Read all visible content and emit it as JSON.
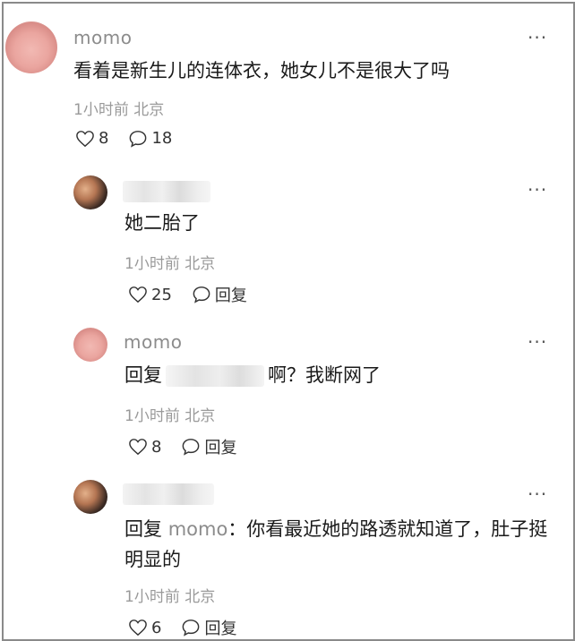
{
  "comments": [
    {
      "username": "momo",
      "text": "看着是新生儿的连体衣，她女儿不是很大了吗",
      "time": "1小时前",
      "location": "北京",
      "likes": "8",
      "replies": "18",
      "more": "···"
    },
    {
      "username": "",
      "text": "她二胎了",
      "time": "1小时前",
      "location": "北京",
      "likes": "25",
      "reply_label": "回复",
      "more": "···"
    },
    {
      "username": "momo",
      "reply_prefix": "回复",
      "text_after": "啊？我断网了",
      "time": "1小时前",
      "location": "北京",
      "likes": "8",
      "reply_label": "回复",
      "more": "···"
    },
    {
      "username": "",
      "reply_prefix": "回复",
      "reply_to": "momo",
      "reply_colon": "：",
      "text_after": "你看最近她的路透就知道了，肚子挺明显的",
      "time": "1小时前",
      "location": "北京",
      "likes": "6",
      "reply_label": "回复",
      "more": "···"
    }
  ]
}
